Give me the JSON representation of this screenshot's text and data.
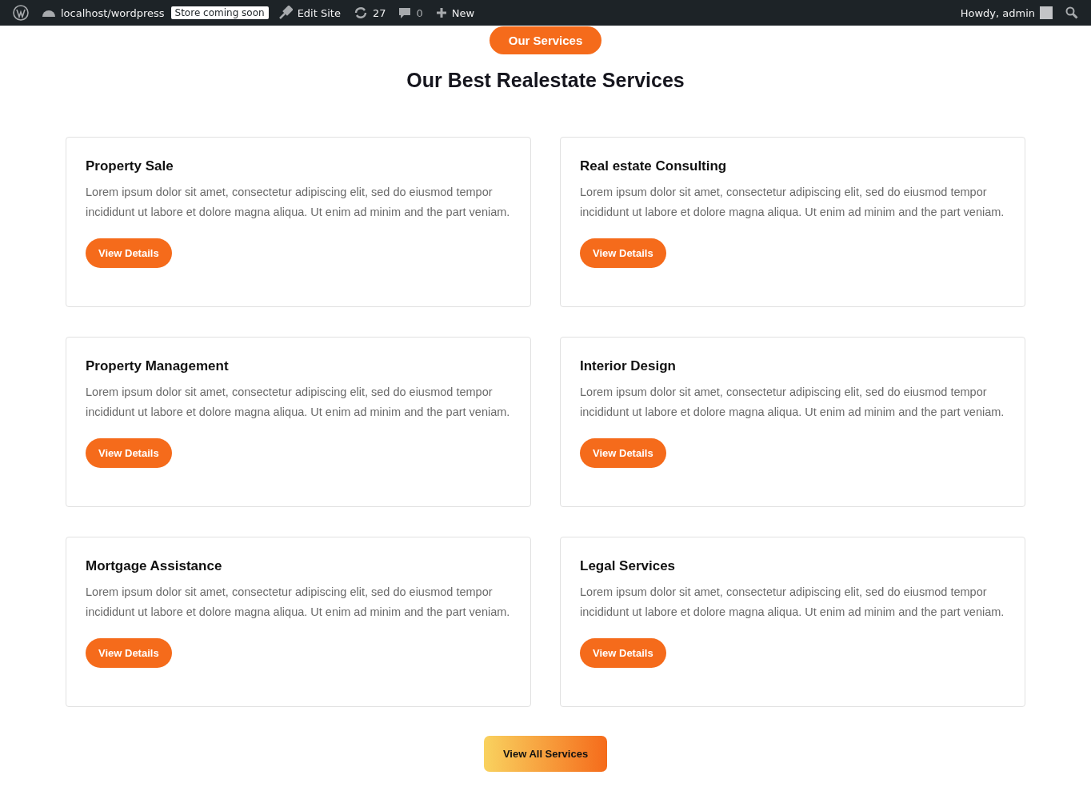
{
  "admin_bar": {
    "site": "localhost/wordpress",
    "badge": "Store coming soon",
    "edit": "Edit Site",
    "updates": "27",
    "comments": "0",
    "new": "New",
    "greeting": "Howdy, admin"
  },
  "section": {
    "tag": "Our Services",
    "title": "Our Best Realestate Services"
  },
  "cards": [
    {
      "title": "Property Sale",
      "text": "Lorem ipsum dolor sit amet, consectetur adipiscing elit, sed do eiusmod tempor incididunt ut labore et dolore magna aliqua. Ut enim ad minim and the part veniam.",
      "button": "View Details"
    },
    {
      "title": "Real estate Consulting",
      "text": "Lorem ipsum dolor sit amet, consectetur adipiscing elit, sed do eiusmod tempor incididunt ut labore et dolore magna aliqua. Ut enim ad minim and the part veniam.",
      "button": "View Details"
    },
    {
      "title": "Property Management",
      "text": "Lorem ipsum dolor sit amet, consectetur adipiscing elit, sed do eiusmod tempor incididunt ut labore et dolore magna aliqua. Ut enim ad minim and the part veniam.",
      "button": "View Details"
    },
    {
      "title": "Interior Design",
      "text": "Lorem ipsum dolor sit amet, consectetur adipiscing elit, sed do eiusmod tempor incididunt ut labore et dolore magna aliqua. Ut enim ad minim and the part veniam.",
      "button": "View Details"
    },
    {
      "title": "Mortgage Assistance",
      "text": "Lorem ipsum dolor sit amet, consectetur adipiscing elit, sed do eiusmod tempor incididunt ut labore et dolore magna aliqua. Ut enim ad minim and the part veniam.",
      "button": "View Details"
    },
    {
      "title": "Legal Services",
      "text": "Lorem ipsum dolor sit amet, consectetur adipiscing elit, sed do eiusmod tempor incididunt ut labore et dolore magna aliqua. Ut enim ad minim and the part veniam.",
      "button": "View Details"
    }
  ],
  "view_all": "View All Services"
}
